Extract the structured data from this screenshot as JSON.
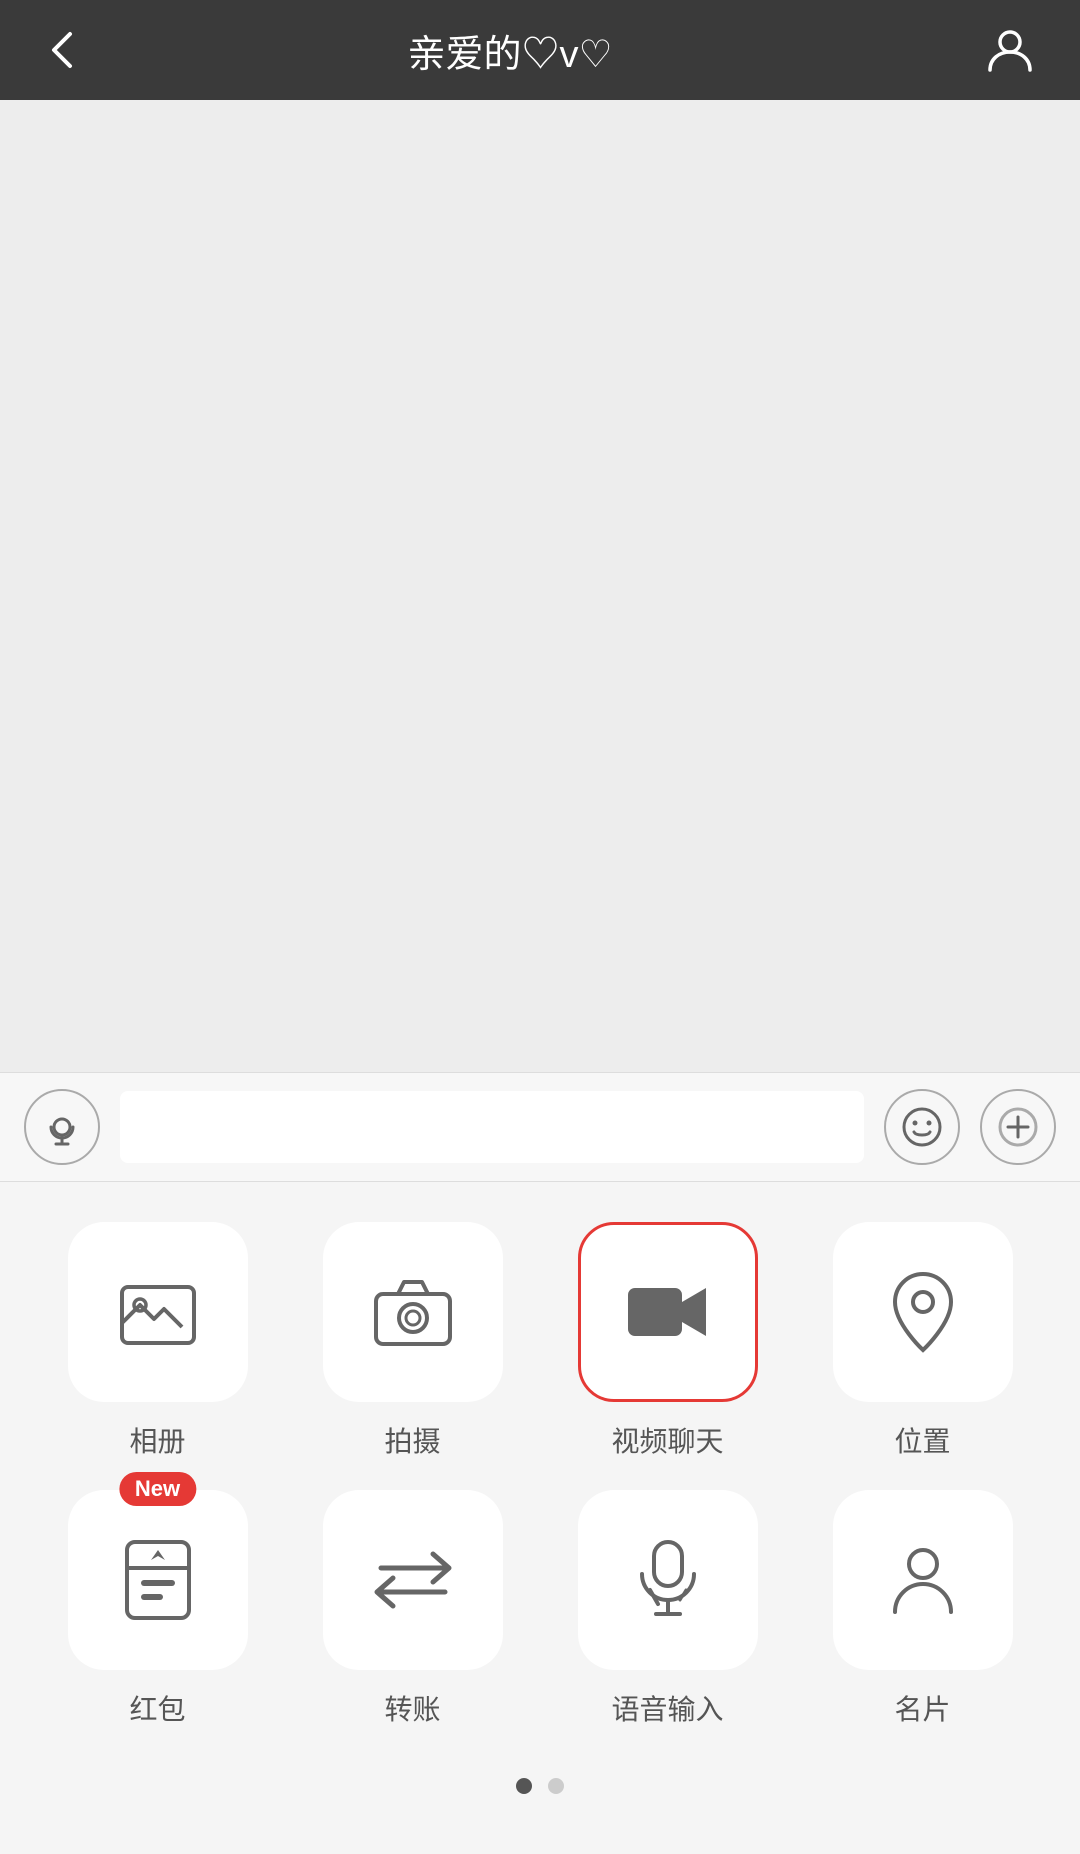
{
  "header": {
    "back_label": "←",
    "title": "亲爱的♡v♡",
    "avatar_label": ""
  },
  "input_bar": {
    "audio_label": "audio",
    "emoji_label": "😊",
    "plus_label": "+"
  },
  "panel": {
    "items_row1": [
      {
        "id": "album",
        "label": "相册",
        "selected": false,
        "new": false
      },
      {
        "id": "camera",
        "label": "拍摄",
        "selected": false,
        "new": false
      },
      {
        "id": "video-chat",
        "label": "视频聊天",
        "selected": true,
        "new": false
      },
      {
        "id": "location",
        "label": "位置",
        "selected": false,
        "new": false
      }
    ],
    "items_row2": [
      {
        "id": "red-packet",
        "label": "红包",
        "selected": false,
        "new": true
      },
      {
        "id": "transfer",
        "label": "转账",
        "selected": false,
        "new": false
      },
      {
        "id": "voice-input",
        "label": "语音输入",
        "selected": false,
        "new": false
      },
      {
        "id": "business-card",
        "label": "名片",
        "selected": false,
        "new": false
      }
    ],
    "new_badge_text": "New"
  },
  "pagination": {
    "dots": [
      true,
      false
    ]
  }
}
